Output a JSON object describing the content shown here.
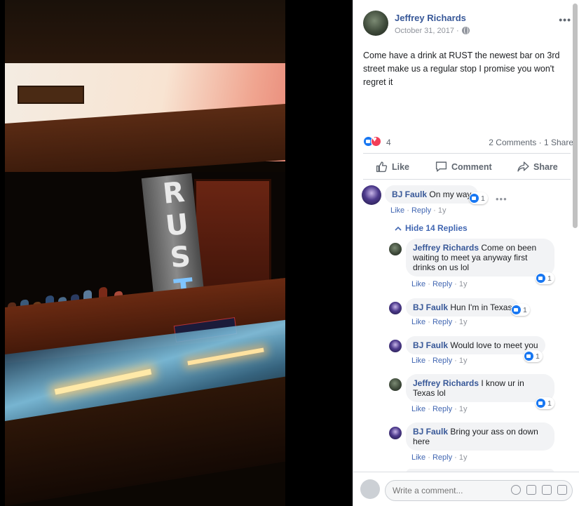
{
  "photo": {
    "sign_letters": [
      "R",
      "U",
      "S",
      "T"
    ]
  },
  "post": {
    "author": "Jeffrey Richards",
    "date": "October 31, 2017 ·",
    "text": "Come have a drink at RUST the newest bar on 3rd street make us a regular stop I promise you won't regret it",
    "reaction_count": "4",
    "comments_shares": "2 Comments · 1 Share",
    "actions": {
      "like": "Like",
      "comment": "Comment",
      "share": "Share"
    }
  },
  "top_comment": {
    "name": "BJ Faulk",
    "text": "On my way",
    "reactions": "1",
    "like": "Like",
    "reply": "Reply",
    "age": "1y"
  },
  "hide_replies": "Hide 14 Replies",
  "replies": [
    {
      "name": "Jeffrey Richards",
      "text": "Come on been waiting to meet ya anyway first drinks on us lol",
      "reactions": "1",
      "like": "Like",
      "reply": "Reply",
      "age": "1y"
    },
    {
      "name": "BJ Faulk",
      "text": "Hun I'm in Texas",
      "reactions": "1",
      "like": "Like",
      "reply": "Reply",
      "age": "1y"
    },
    {
      "name": "BJ Faulk",
      "text": "Would love to meet you",
      "reactions": "1",
      "like": "Like",
      "reply": "Reply",
      "age": "1y"
    },
    {
      "name": "Jeffrey Richards",
      "text": "I know ur in Texas lol",
      "reactions": "1",
      "like": "Like",
      "reply": "Reply",
      "age": "1y"
    },
    {
      "name": "BJ Faulk",
      "text": "Bring your ass on down here",
      "like": "Like",
      "reply": "Reply",
      "age": "1y"
    }
  ],
  "composer": {
    "placeholder": "Write a comment..."
  },
  "colors": {
    "link": "#385898",
    "accent": "#1877f2",
    "muted": "#90949c"
  }
}
